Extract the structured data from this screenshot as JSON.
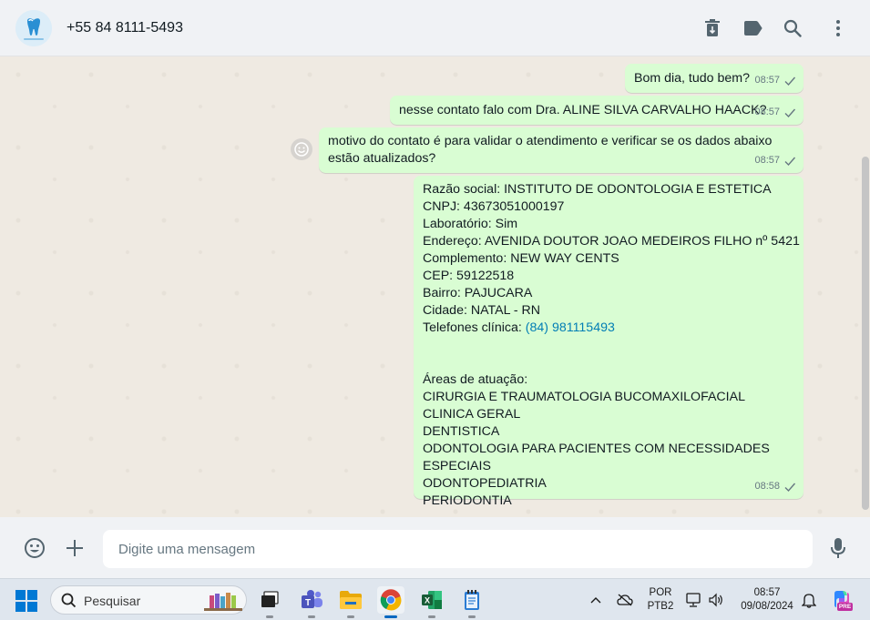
{
  "header": {
    "contact_name": "+55 84 8111-5493"
  },
  "messages": [
    {
      "text": "Bom dia, tudo bem?",
      "time": "08:57"
    },
    {
      "text": "nesse contato falo com Dra. ALINE SILVA CARVALHO HAACK?",
      "time": "08:57"
    },
    {
      "text": "motivo do contato é para validar o atendimento e verificar se os dados abaixo\nestão atualizados?",
      "time": "08:57"
    },
    {
      "lines_before_link": "Razão social: INSTITUTO DE ODONTOLOGIA E ESTETICA\nCNPJ: 43673051000197\nLaboratório: Sim\nEndereço: AVENIDA DOUTOR JOAO MEDEIROS FILHO nº 5421\nComplemento: NEW WAY CENTS\nCEP: 59122518\nBairro: PAJUCARA\nCidade: NATAL - RN\nTelefones clínica: ",
      "link": "(84) 981115493",
      "lines_after_link": "\n\n\nÁreas de atuação:\nCIRURGIA E TRAUMATOLOGIA BUCOMAXILOFACIAL\nCLINICA GERAL\nDENTISTICA\nODONTOLOGIA PARA PACIENTES COM NECESSIDADES ESPECIAIS\nODONTOPEDIATRIA\nPERIODONTIA",
      "time": "08:58"
    }
  ],
  "compose": {
    "placeholder": "Digite uma mensagem"
  },
  "taskbar": {
    "search_label": "Pesquisar",
    "language_top": "POR",
    "language_bottom": "PTB2",
    "clock_time": "08:57",
    "clock_date": "09/08/2024",
    "copilot_badge": "PRE"
  },
  "colors": {
    "outgoing_bubble": "#d9fdd3",
    "chat_bg": "#efeae2",
    "header_bg": "#f0f2f5",
    "link": "#027eb5"
  }
}
